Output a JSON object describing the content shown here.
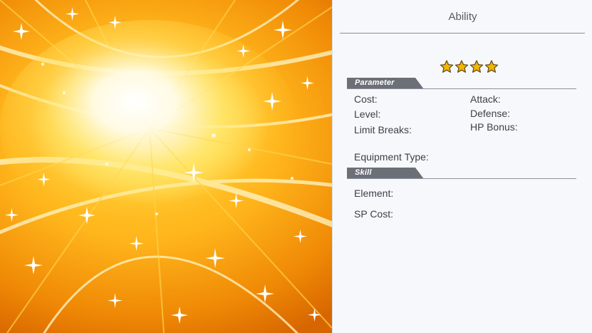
{
  "panel": {
    "title": "Ability",
    "rarity_stars": 4
  },
  "sections": {
    "parameter": {
      "label": "Parameter",
      "fields": {
        "cost": "Cost:",
        "level": "Level:",
        "limit_breaks": "Limit Breaks:",
        "attack": "Attack:",
        "defense": "Defense:",
        "hp_bonus": "HP Bonus:",
        "equipment_type": "Equipment Type:"
      }
    },
    "skill": {
      "label": "Skill",
      "fields": {
        "element": "Element:",
        "sp_cost": "SP Cost:"
      }
    }
  },
  "colors": {
    "panel_bg": "#f6f8fc",
    "tab_dark": "#6b6f77",
    "star_gold": "#f4b400",
    "art_core": "#fff6b0",
    "art_edge": "#e07000"
  },
  "icons": {
    "star": "star-icon",
    "artwork": "ability-art-burst"
  }
}
